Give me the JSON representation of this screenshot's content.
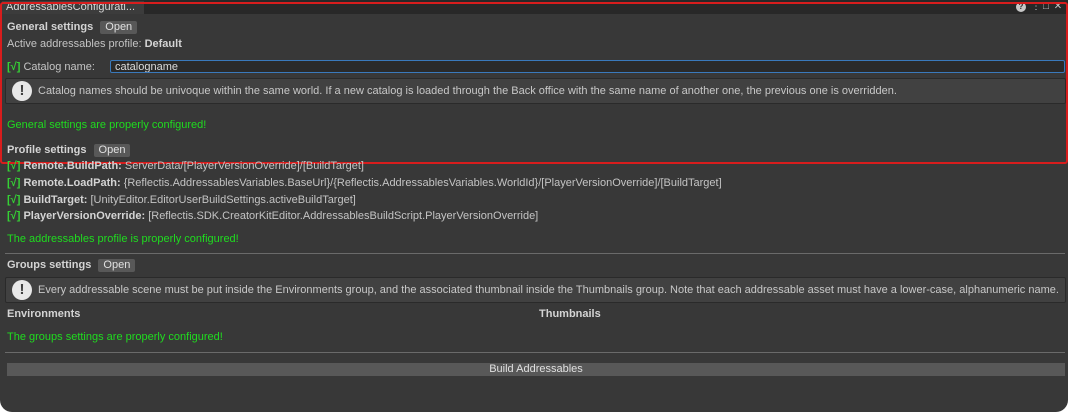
{
  "window": {
    "tab_title": "AddressablesConfigurati...",
    "controls": {
      "help": "help-icon",
      "menu": "kebab-icon",
      "maximize": "maximize-icon",
      "close": "close-icon"
    }
  },
  "general": {
    "heading": "General settings",
    "open_label": "Open",
    "active_profile_label": "Active addressables profile:",
    "active_profile_value": "Default",
    "catalog_check": "[√]",
    "catalog_label": "Catalog name:",
    "catalog_value": "catalogname",
    "info": "Catalog names should be univoque within the same world. If a new catalog is loaded through the Back office with the same name of another one, the previous one is overridden.",
    "status": "General settings are properly configured!"
  },
  "profile": {
    "heading": "Profile settings",
    "open_label": "Open",
    "items": [
      {
        "check": "[√]",
        "key": "Remote.BuildPath:",
        "value": "ServerData/[PlayerVersionOverride]/[BuildTarget]"
      },
      {
        "check": "[√]",
        "key": "Remote.LoadPath:",
        "value": "{Reflectis.AddressablesVariables.BaseUrl}/{Reflectis.AddressablesVariables.WorldId}/[PlayerVersionOverride]/[BuildTarget]"
      },
      {
        "check": "[√]",
        "key": "BuildTarget:",
        "value": "[UnityEditor.EditorUserBuildSettings.activeBuildTarget]"
      },
      {
        "check": "[√]",
        "key": "PlayerVersionOverride:",
        "value": "[Reflectis.SDK.CreatorKitEditor.AddressablesBuildScript.PlayerVersionOverride]"
      }
    ],
    "status": "The addressables profile is properly configured!"
  },
  "groups": {
    "heading": "Groups settings",
    "open_label": "Open",
    "info": "Every addressable scene must be put inside the Environments group, and the associated thumbnail inside the Thumbnails group. Note that each addressable asset must have a lower-case, alphanumeric name.",
    "col_environments": "Environments",
    "col_thumbnails": "Thumbnails",
    "status": "The groups settings are properly configured!"
  },
  "build_button": "Build Addressables",
  "colors": {
    "background": "#383838",
    "highlight_border": "#d81d1d",
    "success_text": "#1fdc1f",
    "check_mark": "#35d235",
    "input_border": "#3a79bb"
  }
}
